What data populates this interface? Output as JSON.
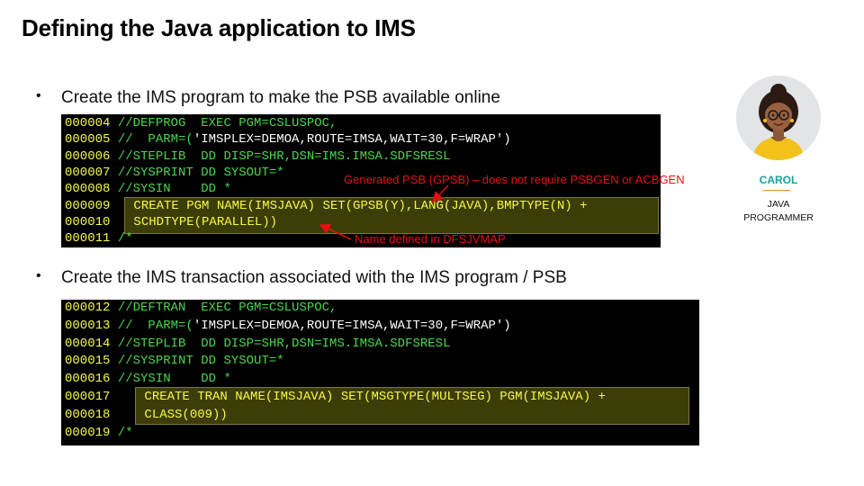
{
  "slide": {
    "title": "Defining the Java application to IMS",
    "bullet1": "Create the IMS program to make the PSB available online",
    "bullet2": "Create the IMS transaction associated with the IMS program / PSB",
    "bullet_symbol": "•"
  },
  "persona": {
    "name": "CAROL",
    "role_line1": "JAVA",
    "role_line2": "PROGRAMMER",
    "icon": "woman-avatar-icon"
  },
  "terminal1": {
    "lines": [
      {
        "seq": "000004",
        "cmd": " //DEFPROG  EXEC PGM=CSLUSPOC,",
        "txt": ""
      },
      {
        "seq": "000005",
        "cmd": " //  PARM=(",
        "txt": "'IMSPLEX=DEMOA,ROUTE=IMSA,WAIT=30,F=WRAP')"
      },
      {
        "seq": "000006",
        "cmd": " //STEPLIB  DD DISP=SHR,DSN=IMS.IMSA.SDFSRESL",
        "txt": ""
      },
      {
        "seq": "000007",
        "cmd": " //SYSPRINT DD SYSOUT=*",
        "txt": ""
      },
      {
        "seq": "000008",
        "cmd": " //SYSIN    DD *",
        "txt": ""
      },
      {
        "seq": "000009",
        "cmd": "",
        "txt": "",
        "hl": "CREATE PGM NAME(IMSJAVA) SET(GPSB(Y),LANG(JAVA),BMPTYPE(N) +"
      },
      {
        "seq": "000010",
        "cmd": "",
        "txt": "",
        "hl": "SCHDTYPE(PARALLEL))"
      },
      {
        "seq": "000011",
        "cmd": " /*",
        "txt": ""
      }
    ],
    "annotation_gpsb": "Generated PSB (GPSB) – does not require PSBGEN or ACBGEN",
    "annotation_name": "Name defined in DFSJVMAP"
  },
  "terminal2": {
    "lines": [
      {
        "seq": "000012",
        "cmd": " //DEFTRAN  EXEC PGM=CSLUSPOC,",
        "txt": ""
      },
      {
        "seq": "000013",
        "cmd": " //  PARM=(",
        "txt": "'IMSPLEX=DEMOA,ROUTE=IMSA,WAIT=30,F=WRAP')"
      },
      {
        "seq": "000014",
        "cmd": " //STEPLIB  DD DISP=SHR,DSN=IMS.IMSA.SDFSRESL",
        "txt": ""
      },
      {
        "seq": "000015",
        "cmd": " //SYSPRINT DD SYSOUT=*",
        "txt": ""
      },
      {
        "seq": "000016",
        "cmd": " //SYSIN    DD *",
        "txt": ""
      },
      {
        "seq": "000017",
        "cmd": "",
        "txt": "",
        "hl": "CREATE TRAN NAME(IMSJAVA) SET(MSGTYPE(MULTSEG) PGM(IMSJAVA) +"
      },
      {
        "seq": "000018",
        "cmd": "",
        "txt": "",
        "hl": "CLASS(009))"
      },
      {
        "seq": "000019",
        "cmd": " /*",
        "txt": ""
      }
    ]
  },
  "colors": {
    "sequence": "#f6f94a",
    "jcl": "#4cd64c",
    "annotation": "#e81010",
    "persona_name": "#1aa39a"
  }
}
